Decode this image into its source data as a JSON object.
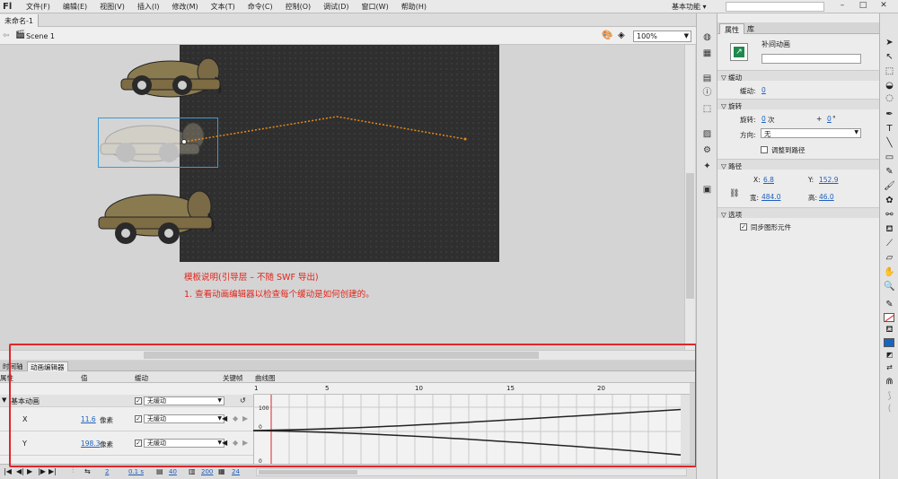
{
  "app": {
    "logo": "Fl"
  },
  "menu": [
    "文件(F)",
    "编辑(E)",
    "视图(V)",
    "插入(I)",
    "修改(M)",
    "文本(T)",
    "命令(C)",
    "控制(O)",
    "调试(D)",
    "窗口(W)",
    "帮助(H)"
  ],
  "workspace": {
    "label": "基本功能 ▾"
  },
  "window_buttons": [
    "–",
    "□",
    "✕"
  ],
  "document": {
    "tab": "未命名-1",
    "scene": "Scene 1",
    "zoom": "100%"
  },
  "stage_text": {
    "line1": "模板说明(引导层 – 不随 SWF 导出)",
    "line2": "1. 查看动画编辑器以检查每个缓动是如何创建的。"
  },
  "timeline": {
    "tabs": [
      "时间轴",
      "动画编辑器"
    ],
    "columns": {
      "property": "属性",
      "value": "值",
      "ease": "缓动",
      "keyframe": "关键帧",
      "graph": "曲线图"
    },
    "ruler": [
      "1",
      "5",
      "10",
      "15",
      "20"
    ],
    "rows": [
      {
        "label": "基本动画",
        "ease": "无缓动"
      },
      {
        "label": "X",
        "value": "11.6",
        "unit": "像素",
        "ease": "无缓动",
        "axis_top": "100",
        "axis_bottom": "0"
      },
      {
        "label": "Y",
        "value": "198.3",
        "unit": "像素",
        "ease": "无缓动",
        "axis_bottom": "0"
      }
    ],
    "footer": {
      "frames": "2",
      "time": "0.1 s",
      "v1": "40",
      "v2": "200",
      "v3": "24"
    }
  },
  "properties": {
    "tabs": [
      "属性",
      "库"
    ],
    "title": "补间动画",
    "instance_name": "",
    "ease_section": "缓动",
    "ease_label": "缓动:",
    "ease_value": "0",
    "rotation_section": "旋转",
    "rotate_label": "旋转:",
    "rotate_count": "0",
    "rotate_unit": "次",
    "rotate_plus": "+",
    "rotate_deg": "0",
    "rotate_deg_unit": "°",
    "direction_label": "方向:",
    "direction_value": "无",
    "orient_to_path": "调整到路径",
    "path_section": "路径",
    "x_label": "X:",
    "x_value": "6.8",
    "y_label": "Y:",
    "y_value": "152.9",
    "w_label": "宽:",
    "w_value": "484.0",
    "h_label": "高:",
    "h_value": "46.0",
    "options_section": "选项",
    "sync_label": "同步图形元件"
  }
}
